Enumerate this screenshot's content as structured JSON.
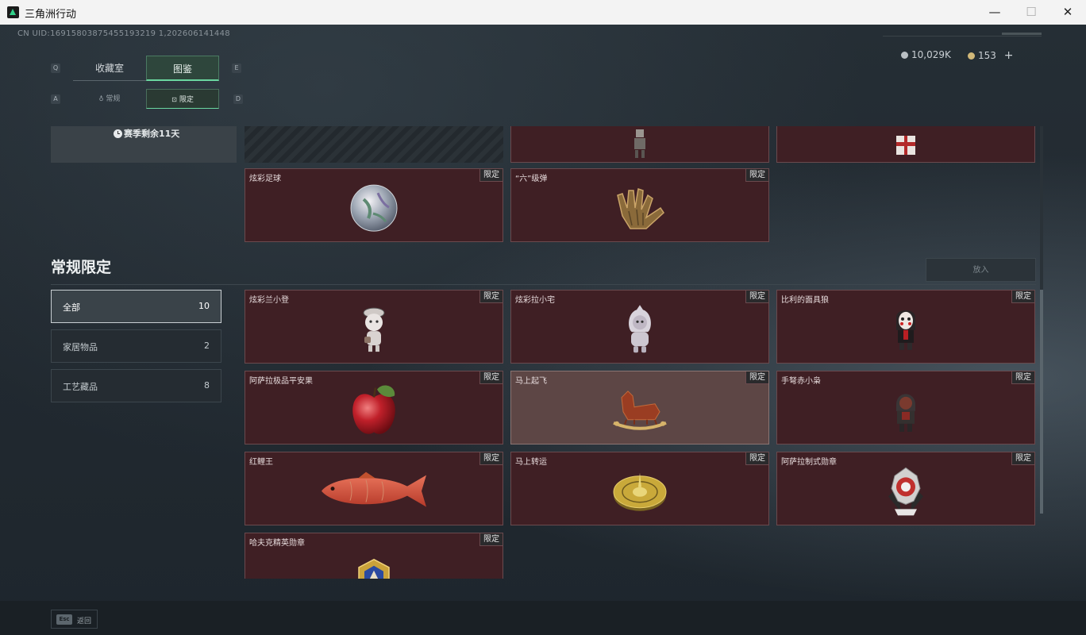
{
  "window": {
    "title": "三角洲行动",
    "minimize": "—",
    "maximize": "☐",
    "close": "✕"
  },
  "header": {
    "uid": "CN UID:16915803875455193219 1,202606141448",
    "silver": "10,029K",
    "gold": "153",
    "add": "+"
  },
  "tabs": {
    "left_key": "Q",
    "right_key": "E",
    "items": [
      {
        "label": "收藏室"
      },
      {
        "label": "图鉴"
      }
    ],
    "active": 1
  },
  "subtabs": {
    "left_key": "A",
    "right_key": "D",
    "items": [
      {
        "label": "常规",
        "icon": "♁"
      },
      {
        "label": "限定",
        "icon": "⊡"
      }
    ],
    "active": 1
  },
  "season": {
    "text": "赛季剩余11天"
  },
  "upper_cards": [
    {
      "name": "炫彩足球",
      "badge": "限定",
      "icon": "soccer-ball-icon"
    },
    {
      "name": "“六”级弹",
      "badge": "限定",
      "icon": "golden-hand-icon"
    }
  ],
  "section": {
    "title": "常规限定",
    "put_button": "放入"
  },
  "filters": [
    {
      "label": "全部",
      "count": "10"
    },
    {
      "label": "家居物品",
      "count": "2"
    },
    {
      "label": "工艺藏品",
      "count": "8"
    }
  ],
  "cards": [
    {
      "name": "炫彩兰小登",
      "badge": "限定",
      "icon": "doll-icon"
    },
    {
      "name": "炫彩拉小宅",
      "badge": "限定",
      "icon": "hooded-doll-icon"
    },
    {
      "name": "比利的面具狼",
      "badge": "限定",
      "icon": "masked-figure-icon"
    },
    {
      "name": "阿萨拉极品平安果",
      "badge": "限定",
      "icon": "apple-icon"
    },
    {
      "name": "马上起飞",
      "badge": "限定",
      "icon": "rocking-horse-icon"
    },
    {
      "name": "手弩赤小枭",
      "badge": "限定",
      "icon": "hooded-figure-icon"
    },
    {
      "name": "红鲤王",
      "badge": "限定",
      "icon": "carp-fish-icon"
    },
    {
      "name": "马上转运",
      "badge": "限定",
      "icon": "compass-disc-icon"
    },
    {
      "name": "阿萨拉制式勋章",
      "badge": "限定",
      "icon": "medal-icon"
    },
    {
      "name": "哈夫克精英勋章",
      "badge": "限定",
      "icon": "gold-badge-icon"
    }
  ],
  "footer": {
    "esc_key": "Esc",
    "esc_label": "返回"
  }
}
